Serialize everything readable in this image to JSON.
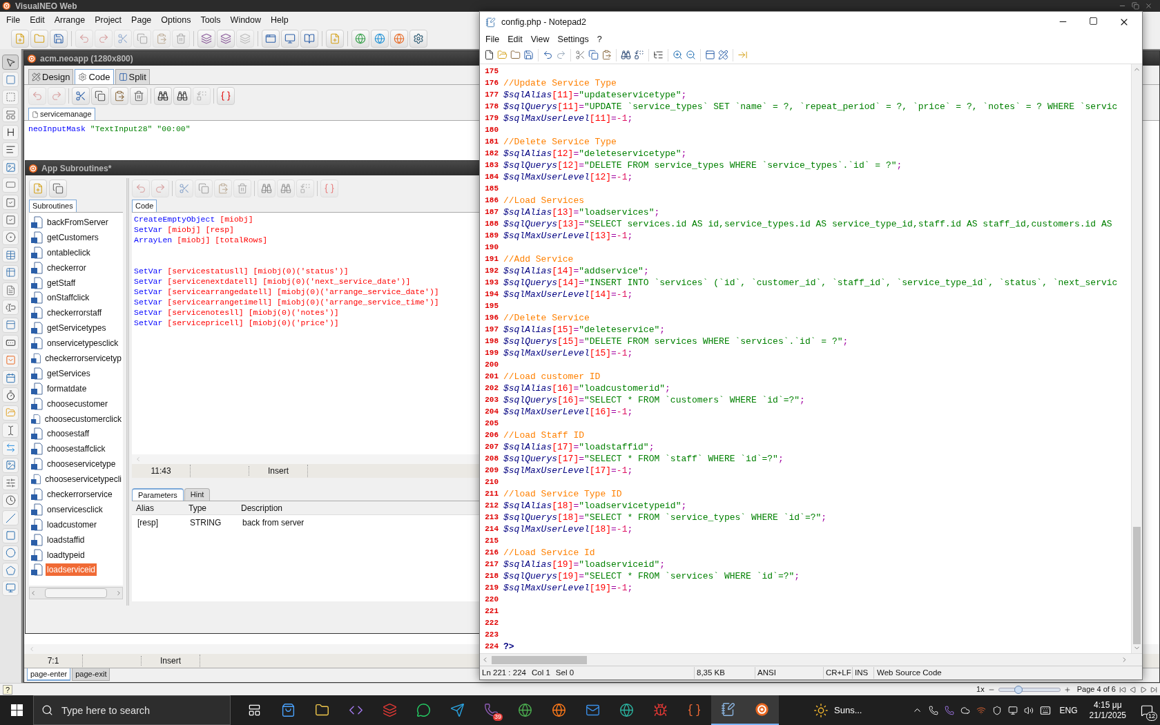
{
  "visualneo": {
    "title": "VisualNEO Web",
    "menu": [
      "File",
      "Edit",
      "Arrange",
      "Project",
      "Page",
      "Options",
      "Tools",
      "Window",
      "Help"
    ],
    "document": {
      "title": "acm.neoapp (1280x800)",
      "view_tabs": [
        {
          "label": "Design",
          "selected": false
        },
        {
          "label": "Code",
          "selected": true
        },
        {
          "label": "Split",
          "selected": false
        }
      ],
      "file_tabs": [
        {
          "label": "servicemanage",
          "selected": true
        }
      ],
      "code": [
        {
          "kind": "strings",
          "command": "neoInputMask",
          "args": "\"TextInput28\" \"00:00\""
        }
      ],
      "status": [
        "7:1",
        "Insert"
      ],
      "event_tabs": [
        {
          "label": "page-enter",
          "selected": true
        },
        {
          "label": "page-exit",
          "selected": false
        }
      ]
    },
    "subroutines": {
      "title": "App Subroutines*",
      "list_tab": "Subroutines",
      "items": [
        {
          "label": "backFromServer",
          "selected": false
        },
        {
          "label": "getCustomers",
          "selected": false
        },
        {
          "label": "ontableclick",
          "selected": false
        },
        {
          "label": "checkerror",
          "selected": false
        },
        {
          "label": "getStaff",
          "selected": false
        },
        {
          "label": "onStaffclick",
          "selected": false
        },
        {
          "label": "checkerrorstaff",
          "selected": false
        },
        {
          "label": "getServicetypes",
          "selected": false
        },
        {
          "label": "onservicetypesclick",
          "selected": false
        },
        {
          "label": "checkerrorservicetyp",
          "selected": false
        },
        {
          "label": "getServices",
          "selected": false
        },
        {
          "label": "formatdate",
          "selected": false
        },
        {
          "label": "choosecustomer",
          "selected": false
        },
        {
          "label": "choosecustomerclick",
          "selected": false
        },
        {
          "label": "choosestaff",
          "selected": false
        },
        {
          "label": "choosestaffclick",
          "selected": false
        },
        {
          "label": "chooseservicetype",
          "selected": false
        },
        {
          "label": "chooseservicetypecli",
          "selected": false
        },
        {
          "label": "checkerrorservice",
          "selected": false
        },
        {
          "label": "onservicesclick",
          "selected": false
        },
        {
          "label": "loadcustomer",
          "selected": false
        },
        {
          "label": "loadstaffid",
          "selected": false
        },
        {
          "label": "loadtypeid",
          "selected": false
        },
        {
          "label": "loadserviceid",
          "selected": true
        }
      ],
      "code_tab": "Code",
      "code": [
        {
          "kind": "variables",
          "command": "CreateEmptyObject",
          "args": "[miobj]"
        },
        {
          "kind": "variables",
          "command": "SetVar",
          "args": "[miobj] [resp]"
        },
        {
          "kind": "variables",
          "command": "ArrayLen",
          "args": "[miobj] [totalRows]"
        },
        {
          "kind": "blank"
        },
        {
          "kind": "blank"
        },
        {
          "kind": "variables",
          "command": "SetVar",
          "args": "[servicestatusll] [miobj(0)('status')]"
        },
        {
          "kind": "variables",
          "command": "SetVar",
          "args": "[servicenextdatell] [miobj(0)('next_service_date')]"
        },
        {
          "kind": "variables",
          "command": "SetVar",
          "args": "[servicearrangedatell] [miobj(0)('arrange_service_date')]"
        },
        {
          "kind": "variables",
          "command": "SetVar",
          "args": "[servicearrangetimell] [miobj(0)('arrange_service_time')]"
        },
        {
          "kind": "variables",
          "command": "SetVar",
          "args": "[servicenotesll] [miobj(0)('notes')]"
        },
        {
          "kind": "variables",
          "command": "SetVar",
          "args": "[servicepricell] [miobj(0)('price')]"
        }
      ],
      "status": [
        "11:43",
        "Insert"
      ],
      "param_tabs": [
        {
          "label": "Parameters",
          "selected": true
        },
        {
          "label": "Hint",
          "selected": false
        }
      ],
      "params": {
        "columns": [
          "Alias",
          "Type",
          "Description"
        ],
        "rows": [
          [
            "[resp]",
            "STRING",
            "back from server"
          ]
        ]
      }
    },
    "status_bar": {
      "help": "?",
      "zoom": "1x",
      "zoom_slider": {
        "level": 0.3
      },
      "page": "Page 4 of 6"
    }
  },
  "notepad": {
    "title": "config.php - Notepad2",
    "menu": [
      "File",
      "Edit",
      "View",
      "Settings",
      "?"
    ],
    "lines": [
      {
        "number": "175",
        "kind": "blank"
      },
      {
        "number": "176",
        "kind": "comment",
        "text": "//Update Service Type"
      },
      {
        "number": "177",
        "kind": "string",
        "var": "$sqlAlias",
        "index": "[11]",
        "op": "=",
        "value": "\"updateservicetype\"",
        "end": ";"
      },
      {
        "number": "178",
        "kind": "string",
        "var": "$sqlQuerys",
        "index": "[11]",
        "op": "=",
        "value": "\"UPDATE `service_types` SET `name` = ?, `repeat_period` = ?, `price` = ?, `notes` = ? WHERE `servic"
      },
      {
        "number": "179",
        "kind": "numeric",
        "var": "$sqlMaxUserLevel",
        "index": "[11]",
        "op": "=",
        "value": "-1",
        "end": ";"
      },
      {
        "number": "180",
        "kind": "blank"
      },
      {
        "number": "181",
        "kind": "comment",
        "text": "//Delete Service Type"
      },
      {
        "number": "182",
        "kind": "string",
        "var": "$sqlAlias",
        "index": "[12]",
        "op": "=",
        "value": "\"deleteservicetype\"",
        "end": ";"
      },
      {
        "number": "183",
        "kind": "string",
        "var": "$sqlQuerys",
        "index": "[12]",
        "op": "=",
        "value": "\"DELETE FROM service_types WHERE `service_types`.`id` = ?\"",
        "end": ";"
      },
      {
        "number": "184",
        "kind": "numeric",
        "var": "$sqlMaxUserLevel",
        "index": "[12]",
        "op": "=",
        "value": "-1",
        "end": ";"
      },
      {
        "number": "185",
        "kind": "blank"
      },
      {
        "number": "186",
        "kind": "comment",
        "text": "//Load Services"
      },
      {
        "number": "187",
        "kind": "string",
        "var": "$sqlAlias",
        "index": "[13]",
        "op": "=",
        "value": "\"loadservices\"",
        "end": ";"
      },
      {
        "number": "188",
        "kind": "string",
        "var": "$sqlQuerys",
        "index": "[13]",
        "op": "=",
        "value": "\"SELECT services.id AS id,service_types.id AS service_type_id,staff.id AS staff_id,customers.id AS"
      },
      {
        "number": "189",
        "kind": "numeric",
        "var": "$sqlMaxUserLevel",
        "index": "[13]",
        "op": "=",
        "value": "-1",
        "end": ";"
      },
      {
        "number": "190",
        "kind": "blank"
      },
      {
        "number": "191",
        "kind": "comment",
        "text": "//Add Service"
      },
      {
        "number": "192",
        "kind": "string",
        "var": "$sqlAlias",
        "index": "[14]",
        "op": "=",
        "value": "\"addservice\"",
        "end": ";"
      },
      {
        "number": "193",
        "kind": "string",
        "var": "$sqlQuerys",
        "index": "[14]",
        "op": "=",
        "value": "\"INSERT INTO `services` (`id`, `customer_id`, `staff_id`, `service_type_id`, `status`, `next_servic"
      },
      {
        "number": "194",
        "kind": "numeric",
        "var": "$sqlMaxUserLevel",
        "index": "[14]",
        "op": "=",
        "value": "-1",
        "end": ";"
      },
      {
        "number": "195",
        "kind": "blank"
      },
      {
        "number": "196",
        "kind": "comment",
        "text": "//Delete Service"
      },
      {
        "number": "197",
        "kind": "string",
        "var": "$sqlAlias",
        "index": "[15]",
        "op": "=",
        "value": "\"deleteservice\"",
        "end": ";"
      },
      {
        "number": "198",
        "kind": "string",
        "var": "$sqlQuerys",
        "index": "[15]",
        "op": "=",
        "value": "\"DELETE FROM services WHERE `services`.`id` = ?\"",
        "end": ";"
      },
      {
        "number": "199",
        "kind": "numeric",
        "var": "$sqlMaxUserLevel",
        "index": "[15]",
        "op": "=",
        "value": "-1",
        "end": ";"
      },
      {
        "number": "200",
        "kind": "blank"
      },
      {
        "number": "201",
        "kind": "comment",
        "text": "//Load customer ID"
      },
      {
        "number": "202",
        "kind": "string",
        "var": "$sqlAlias",
        "index": "[16]",
        "op": "=",
        "value": "\"loadcustomerid\"",
        "end": ";"
      },
      {
        "number": "203",
        "kind": "string",
        "var": "$sqlQuerys",
        "index": "[16]",
        "op": "=",
        "value": "\"SELECT * FROM `customers` WHERE `id`=?\"",
        "end": ";"
      },
      {
        "number": "204",
        "kind": "numeric",
        "var": "$sqlMaxUserLevel",
        "index": "[16]",
        "op": "=",
        "value": "-1",
        "end": ";"
      },
      {
        "number": "205",
        "kind": "blank"
      },
      {
        "number": "206",
        "kind": "comment",
        "text": "//Load Staff ID"
      },
      {
        "number": "207",
        "kind": "string",
        "var": "$sqlAlias",
        "index": "[17]",
        "op": "=",
        "value": "\"loadstaffid\"",
        "end": ";"
      },
      {
        "number": "208",
        "kind": "string",
        "var": "$sqlQuerys",
        "index": "[17]",
        "op": "=",
        "value": "\"SELECT * FROM `staff` WHERE `id`=?\"",
        "end": ";"
      },
      {
        "number": "209",
        "kind": "numeric",
        "var": "$sqlMaxUserLevel",
        "index": "[17]",
        "op": "=",
        "value": "-1",
        "end": ";"
      },
      {
        "number": "210",
        "kind": "blank"
      },
      {
        "number": "211",
        "kind": "comment",
        "text": "//load Service Type ID"
      },
      {
        "number": "212",
        "kind": "string",
        "var": "$sqlAlias",
        "index": "[18]",
        "op": "=",
        "value": "\"loadservicetypeid\"",
        "end": ";"
      },
      {
        "number": "213",
        "kind": "string",
        "var": "$sqlQuerys",
        "index": "[18]",
        "op": "=",
        "value": "\"SELECT * FROM `service_types` WHERE `id`=?\"",
        "end": ";"
      },
      {
        "number": "214",
        "kind": "numeric",
        "var": "$sqlMaxUserLevel",
        "index": "[18]",
        "op": "=",
        "value": "-1",
        "end": ";"
      },
      {
        "number": "215",
        "kind": "blank"
      },
      {
        "number": "216",
        "kind": "comment",
        "text": "//Load Service Id"
      },
      {
        "number": "217",
        "kind": "string",
        "var": "$sqlAlias",
        "index": "[19]",
        "op": "=",
        "value": "\"loadserviceid\"",
        "end": ";"
      },
      {
        "number": "218",
        "kind": "string",
        "var": "$sqlQuerys",
        "index": "[19]",
        "op": "=",
        "value": "\"SELECT * FROM `services` WHERE `id`=?\"",
        "end": ";"
      },
      {
        "number": "219",
        "kind": "numeric",
        "var": "$sqlMaxUserLevel",
        "index": "[19]",
        "op": "=",
        "value": "-1",
        "end": ";"
      },
      {
        "number": "220",
        "kind": "blank"
      },
      {
        "number": "221",
        "kind": "blank"
      },
      {
        "number": "222",
        "kind": "blank"
      },
      {
        "number": "223",
        "kind": "blank"
      },
      {
        "number": "224",
        "kind": "close",
        "text": "?>"
      }
    ],
    "status": [
      "Ln 221 : 224",
      "Col 1",
      "Sel 0",
      "8,35 KB",
      "ANSI",
      "CR+LF",
      "INS",
      "Web Source Code"
    ]
  },
  "taskbar": {
    "search_placeholder": "Type here to search",
    "badge": "39",
    "weather": "Suns...",
    "language": "ENG",
    "time": "4:15 μμ",
    "date": "21/1/2025",
    "notifications": "12"
  }
}
